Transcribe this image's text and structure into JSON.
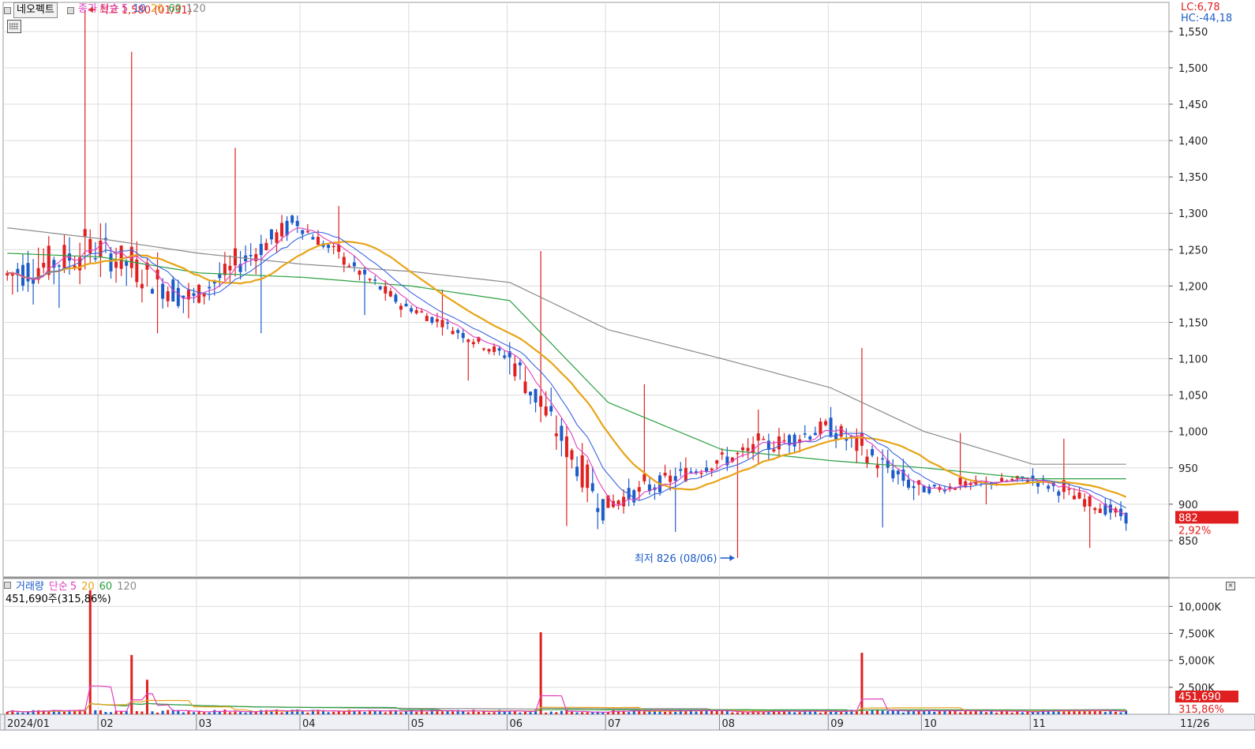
{
  "toolbar": {
    "stock_button": "네오펙트"
  },
  "price_legend": {
    "label": "종가 단순",
    "ma5": "5",
    "ma10": "10",
    "ma20": "20",
    "ma60": "60",
    "ma120": "120"
  },
  "volume_legend": {
    "label": "거래량",
    "method": "단순",
    "ma5": "5",
    "ma20": "20",
    "ma60": "60",
    "ma120": "120",
    "current": "451,690주(315,86%)"
  },
  "indicators": {
    "lc": "LC:6,78",
    "hc": "HC:-44,18"
  },
  "annotations": {
    "high": "최고 1,580 (01/31)",
    "low": "최저 826 (08/06)"
  },
  "current_price": {
    "price": "882",
    "change": "2,92%",
    "volume": "451,690",
    "volume_change": "315,86%"
  },
  "colors": {
    "up": "#e02020",
    "down": "#1c5cc8",
    "ma5": "#e040c0",
    "ma10": "#3a66e0",
    "ma20": "#e8a417",
    "ma60": "#2aa040",
    "ma120": "#8a8a8a",
    "grid": "#dcdcdc"
  },
  "chart_data": [
    {
      "type": "candlestick",
      "title": "네오펙트",
      "y_ticks": [
        "1,550",
        "1,500",
        "1,450",
        "1,400",
        "1,350",
        "1,300",
        "1,250",
        "1,200",
        "1,150",
        "1,100",
        "1,050",
        "1,000",
        "950",
        "900",
        "850"
      ],
      "x_ticks": [
        "2024/01",
        "02",
        "03",
        "04",
        "05",
        "06",
        "07",
        "08",
        "09",
        "10",
        "11",
        "11/26"
      ],
      "ylim": [
        800,
        1590
      ],
      "months": [
        {
          "label": "2024/01",
          "open": 1215,
          "high": 1580,
          "low": 1170,
          "close": 1250,
          "direction": "up",
          "bars": 18
        },
        {
          "label": "02",
          "open": 1250,
          "high": 1522,
          "low": 1135,
          "close": 1180,
          "direction": "down",
          "bars": 19
        },
        {
          "label": "03",
          "open": 1190,
          "high": 1390,
          "low": 1135,
          "close": 1290,
          "direction": "up",
          "bars": 20
        },
        {
          "label": "04",
          "open": 1280,
          "high": 1310,
          "low": 1160,
          "close": 1170,
          "direction": "down",
          "bars": 21
        },
        {
          "label": "05",
          "open": 1170,
          "high": 1195,
          "low": 1070,
          "close": 1105,
          "direction": "down",
          "bars": 19
        },
        {
          "label": "06",
          "open": 1105,
          "high": 1248,
          "low": 870,
          "close": 900,
          "direction": "down",
          "bars": 19
        },
        {
          "label": "07",
          "open": 900,
          "high": 1065,
          "low": 862,
          "close": 960,
          "direction": "up",
          "bars": 22
        },
        {
          "label": "08",
          "open": 960,
          "high": 1030,
          "low": 826,
          "close": 1005,
          "direction": "up",
          "bars": 21
        },
        {
          "label": "09",
          "open": 1005,
          "high": 1115,
          "low": 868,
          "close": 920,
          "direction": "down",
          "bars": 18
        },
        {
          "label": "10",
          "open": 920,
          "high": 998,
          "low": 900,
          "close": 935,
          "direction": "up",
          "bars": 21
        },
        {
          "label": "11",
          "open": 935,
          "high": 990,
          "low": 840,
          "close": 882,
          "direction": "down",
          "bars": 19
        }
      ],
      "moving_averages": {
        "ma20": [
          1235,
          1190,
          1215,
          1235,
          1180,
          1120,
          905,
          945,
          1000,
          920,
          905
        ],
        "ma60": [
          1245,
          1240,
          1218,
          1212,
          1200,
          1180,
          1040,
          975,
          960,
          950,
          935
        ],
        "ma120": [
          1280,
          1265,
          1245,
          1230,
          1220,
          1205,
          1140,
          1100,
          1060,
          1000,
          955
        ]
      }
    },
    {
      "type": "bar",
      "title": "거래량",
      "y_ticks": [
        "10,000K",
        "7,500K",
        "5,000K",
        "2,500K"
      ],
      "ylim": [
        0,
        12000
      ],
      "unit": "K",
      "spikes": [
        {
          "month": "2024/01",
          "value": 11500,
          "direction": "up"
        },
        {
          "month": "02",
          "value": 5500,
          "direction": "up"
        },
        {
          "month": "02",
          "value": 3200,
          "direction": "down"
        },
        {
          "month": "06",
          "value": 7600,
          "direction": "up"
        },
        {
          "month": "09",
          "value": 5700,
          "direction": "up"
        }
      ],
      "baseline_volume": 300
    }
  ]
}
